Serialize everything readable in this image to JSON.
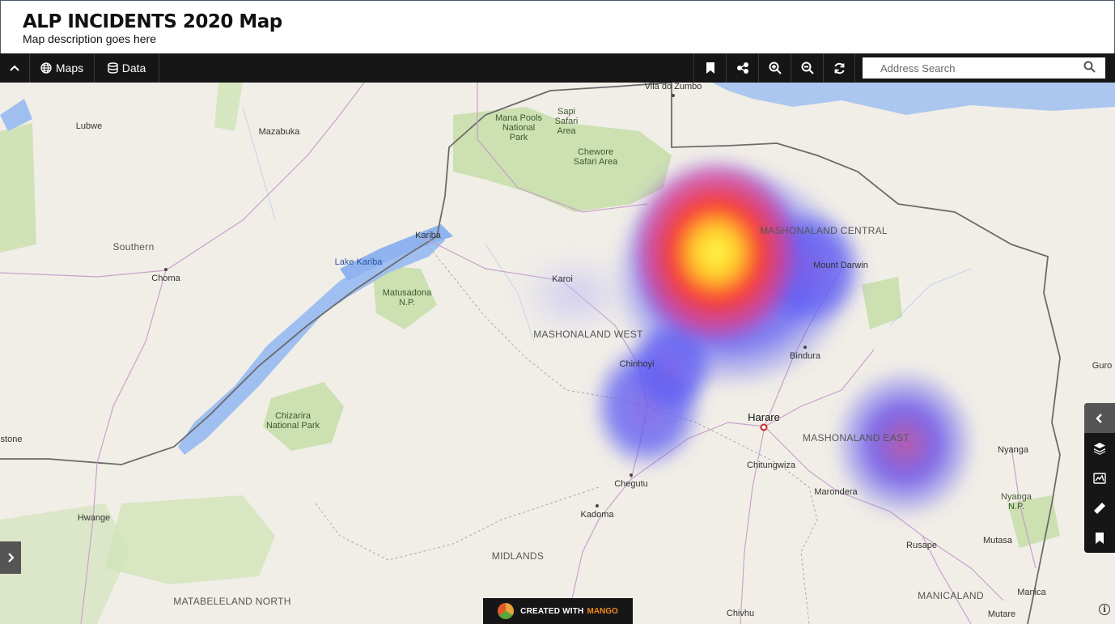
{
  "header": {
    "title": "ALP INCIDENTS 2020 Map",
    "subtitle": "Map description goes here"
  },
  "toolbar": {
    "maps_label": "Maps",
    "data_label": "Data",
    "collapse_icon": "chevron-up-icon",
    "right_icons": [
      "bookmark-icon",
      "share-icon",
      "zoom-in-icon",
      "zoom-out-icon",
      "refresh-icon"
    ]
  },
  "search": {
    "placeholder": "Address Search"
  },
  "side_panel": {
    "icons": [
      "chevron-left-icon",
      "layers-icon",
      "map-card-icon",
      "ruler-icon",
      "bookmark-icon"
    ]
  },
  "map_labels": {
    "vila_do_zumbo": "Vila do Zumbo",
    "lubwe": "Lubwe",
    "mazabuka": "Mazabuka",
    "mana_pools": "Mana Pools\nNational\nPark",
    "sapi": "Sapi\nSafari\nArea",
    "chewore": "Chewore\nSafari Area",
    "southern": "Southern",
    "choma": "Choma",
    "kariba": "Kariba",
    "lake_kariba": "Lake Kariba",
    "matusadona": "Matusadona\nN.P.",
    "karoi": "Karoi",
    "mashonaland_west": "MASHONALAND WEST",
    "mashonaland_central": "MASHONALAND CENTRAL",
    "mount_darwin": "Mount Darwin",
    "bindura": "Bindura",
    "chinhoyi": "Chinhoyi",
    "harare": "Harare",
    "chitungwiza": "Chitungwiza",
    "mashonaland_east": "MASHONALAND EAST",
    "marondera": "Marondera",
    "nyanga": "Nyanga",
    "nyanga_np": "Nyanga\nN.P.",
    "chegutu": "Chegutu",
    "kadoma": "Kadoma",
    "hwange": "Hwange",
    "chizarira": "Chizarira\nNational Park",
    "stone": "stone",
    "midlands": "MIDLANDS",
    "matabeleland_north": "MATABELELAND NORTH",
    "rusape": "Rusape",
    "mutasa": "Mutasa",
    "manicaland": "MANICALAND",
    "manica": "Manica",
    "mutare": "Mutare",
    "chivhu": "Chivhu",
    "guro": "Guro"
  },
  "badge": {
    "created_with": "CREATED WITH",
    "brand": "MANGO"
  },
  "info_glyph": "i"
}
